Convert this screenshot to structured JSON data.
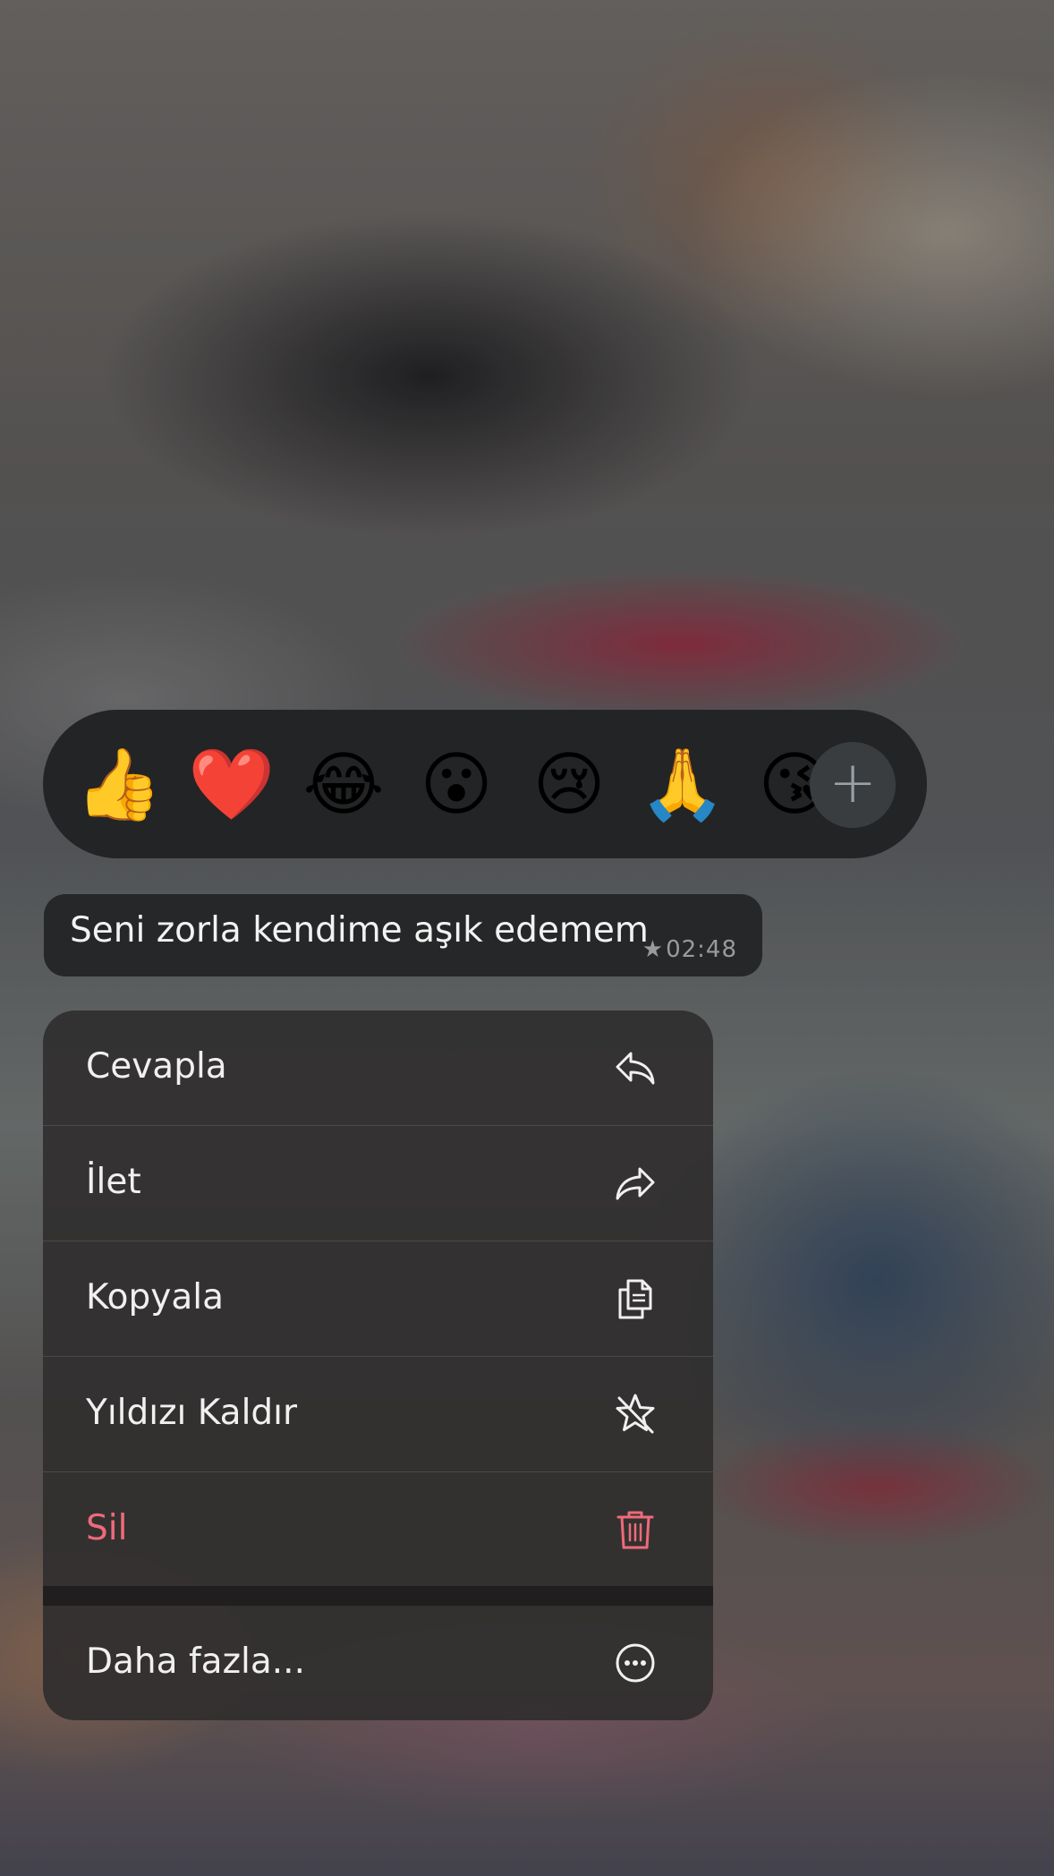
{
  "reactions": {
    "emojis": [
      "👍",
      "❤️",
      "😂",
      "😮",
      "😢",
      "🙏",
      "😘"
    ],
    "more_label": "+"
  },
  "message": {
    "text": "Seni zorla kendime aşık edemem",
    "time": "02:48",
    "starred": true
  },
  "menu": {
    "items": [
      {
        "label": "Cevapla",
        "icon": "reply-icon"
      },
      {
        "label": "İlet",
        "icon": "forward-icon"
      },
      {
        "label": "Kopyala",
        "icon": "copy-icon"
      },
      {
        "label": "Yıldızı Kaldır",
        "icon": "unstar-icon"
      },
      {
        "label": "Sil",
        "icon": "trash-icon",
        "color": "#ef6a7a"
      }
    ],
    "more": {
      "label": "Daha fazla...",
      "icon": "more-icon"
    }
  }
}
